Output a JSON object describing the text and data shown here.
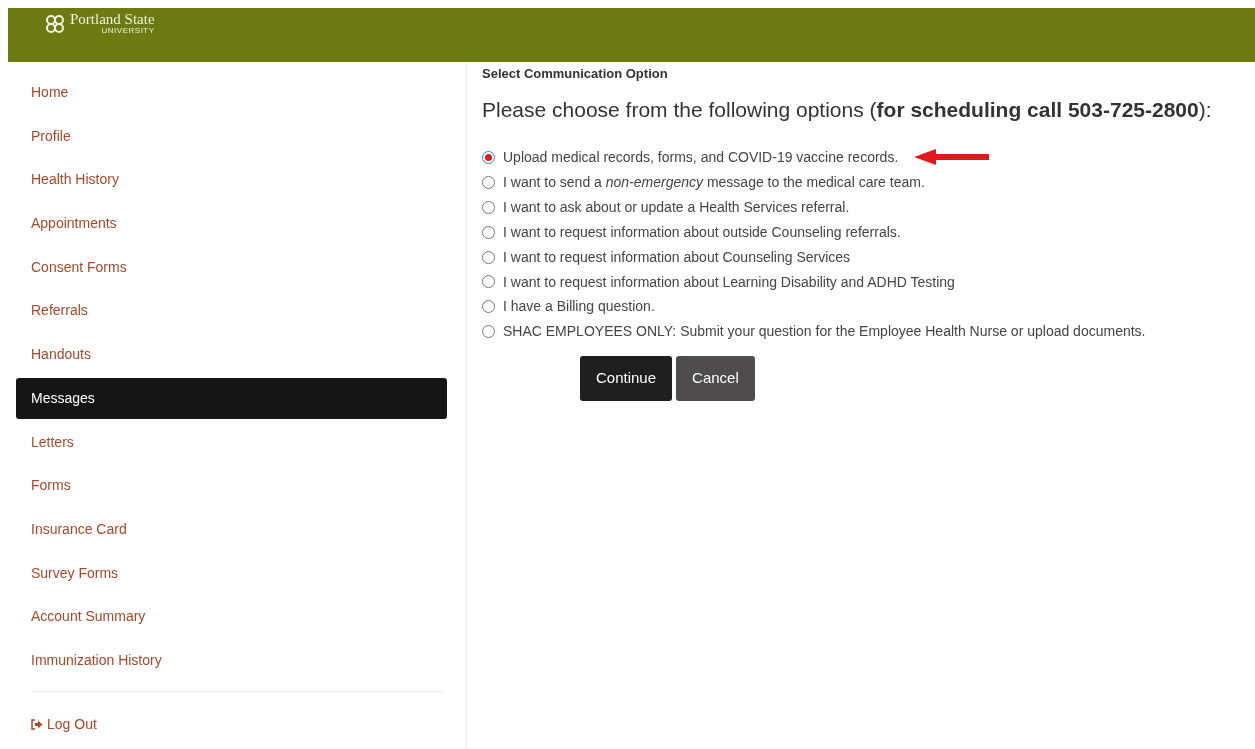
{
  "header": {
    "logo_name": "Portland State",
    "logo_sub": "UNIVERSITY"
  },
  "sidebar": {
    "items": [
      {
        "label": "Home",
        "selected": false
      },
      {
        "label": "Profile",
        "selected": false
      },
      {
        "label": "Health History",
        "selected": false
      },
      {
        "label": "Appointments",
        "selected": false
      },
      {
        "label": "Consent Forms",
        "selected": false
      },
      {
        "label": "Referrals",
        "selected": false
      },
      {
        "label": "Handouts",
        "selected": false
      },
      {
        "label": "Messages",
        "selected": true
      },
      {
        "label": "Letters",
        "selected": false
      },
      {
        "label": "Forms",
        "selected": false
      },
      {
        "label": "Insurance Card",
        "selected": false
      },
      {
        "label": "Survey Forms",
        "selected": false
      },
      {
        "label": "Account Summary",
        "selected": false
      },
      {
        "label": "Immunization History",
        "selected": false
      }
    ],
    "logout": "Log Out"
  },
  "main": {
    "section_title": "Select Communication Option",
    "heading": "Please choose from the following options (**for scheduling call 503-725-2800**):",
    "options": [
      {
        "label": "Upload medical records, forms, and COVID-19 vaccine records.",
        "selected": true
      },
      {
        "label": "I want to send a *non-emergency* message to the medical care team.",
        "selected": false
      },
      {
        "label": "I want to ask about or update a Health Services referral.",
        "selected": false
      },
      {
        "label": "I want to request information about outside Counseling referrals.",
        "selected": false
      },
      {
        "label": "I want to request information about Counseling Services",
        "selected": false
      },
      {
        "label": "I want to request information about Learning Disability and ADHD Testing",
        "selected": false
      },
      {
        "label": "I have a Billing question.",
        "selected": false
      },
      {
        "label": "SHAC EMPLOYEES ONLY: Submit your question for the Employee Health Nurse or upload documents.",
        "selected": false
      }
    ],
    "buttons": [
      {
        "label": "Continue",
        "kind": "primary"
      },
      {
        "label": "Cancel",
        "kind": "secondary"
      }
    ]
  }
}
